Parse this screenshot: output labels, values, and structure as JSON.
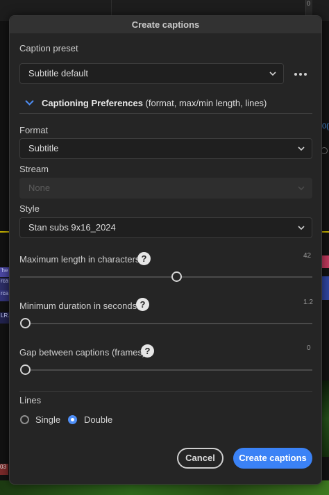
{
  "dialog": {
    "title": "Create captions",
    "caption_preset": {
      "label": "Caption preset",
      "value": "Subtitle default",
      "more_icon": "more-horizontal-icon"
    },
    "preferences": {
      "heading_bold": "Captioning Preferences",
      "heading_rest": " (format, max/min length, lines)",
      "expanded": true
    },
    "format": {
      "label": "Format",
      "value": "Subtitle"
    },
    "stream": {
      "label": "Stream",
      "value": "None",
      "disabled": true
    },
    "style": {
      "label": "Style",
      "value": "Stan subs 9x16_2024"
    },
    "max_length": {
      "label": "Maximum length in characters",
      "value": "42",
      "help": "?"
    },
    "min_duration": {
      "label": "Minimum duration in seconds",
      "value": "1.2",
      "help": "?"
    },
    "gap": {
      "label": "Gap between captions (frames)",
      "value": "0",
      "help": "?"
    },
    "lines": {
      "label": "Lines",
      "options": [
        "Single",
        "Double"
      ],
      "selected": "Double"
    },
    "buttons": {
      "cancel": "Cancel",
      "create": "Create captions"
    }
  },
  "background": {
    "top_right_digit": "0",
    "right_text": "0(",
    "left_clips": [
      "'he",
      "rca",
      "rca",
      "LR."
    ],
    "bottom_left_clip": "03"
  },
  "colors": {
    "accent": "#3b82f6",
    "dialog_bg": "#252525",
    "timeline_yellow": "#c8b400"
  }
}
